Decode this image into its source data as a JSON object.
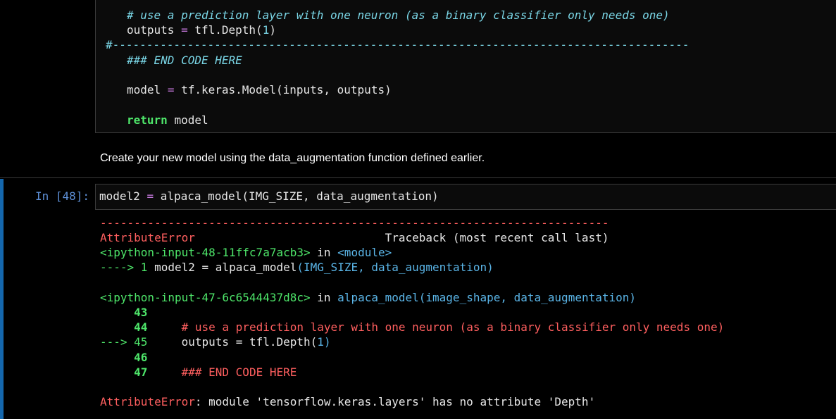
{
  "top_cell": {
    "comment_line": "# use a prediction layer with one neuron (as a binary classifier only needs one)",
    "outputs_var": "outputs",
    "outputs_eq": "=",
    "outputs_call": "tfl.Depth(",
    "outputs_num": "1",
    "outputs_close": ")",
    "separator": "#-------------------------------------------------------------------------------------",
    "end_comment": "### END CODE HERE",
    "model_var": "model",
    "model_eq": "=",
    "model_call": "tf.keras.Model(inputs, outputs)",
    "return_kw": "return",
    "return_val": "model"
  },
  "markdown": {
    "text": "Create your new model using the data_augmentation function defined earlier."
  },
  "active_cell": {
    "prompt": "In [48]:",
    "code_var": "model2",
    "code_eq": "=",
    "code_call": "alpaca_model(IMG_SIZE, data_augmentation)"
  },
  "output": {
    "dash_line": "---------------------------------------------------------------------------",
    "error_name": "AttributeError",
    "traceback_header": "Traceback (most recent call last)",
    "frame1_file": "<ipython-input-48-11ffc7a7acb3>",
    "frame1_in": "in",
    "frame1_module": "<module>",
    "frame1_arrow": "----> 1",
    "frame1_code_var": "model2",
    "frame1_code_eq": "=",
    "frame1_code_fn": "alpaca_model",
    "frame1_code_args": "(IMG_SIZE, data_augmentation)",
    "frame2_file": "<ipython-input-47-6c6544437d8c>",
    "frame2_in": "in",
    "frame2_fn": "alpaca_model",
    "frame2_args": "(image_shape, data_augmentation)",
    "line43": "43",
    "line44": "44",
    "line44_code": "# use a prediction layer with one neuron (as a binary classifier only needs one)",
    "line45_arrow": "--->",
    "line45": "45",
    "line45_var": "outputs",
    "line45_eq": "=",
    "line45_call": "tfl.Depth(",
    "line45_num": "1",
    "line45_close": ")",
    "line46": "46",
    "line47": "47",
    "line47_code": "### END CODE HERE",
    "final_error_name": "AttributeError",
    "final_error_msg": ": module 'tensorflow.keras.layers' has no attribute 'Depth'"
  }
}
